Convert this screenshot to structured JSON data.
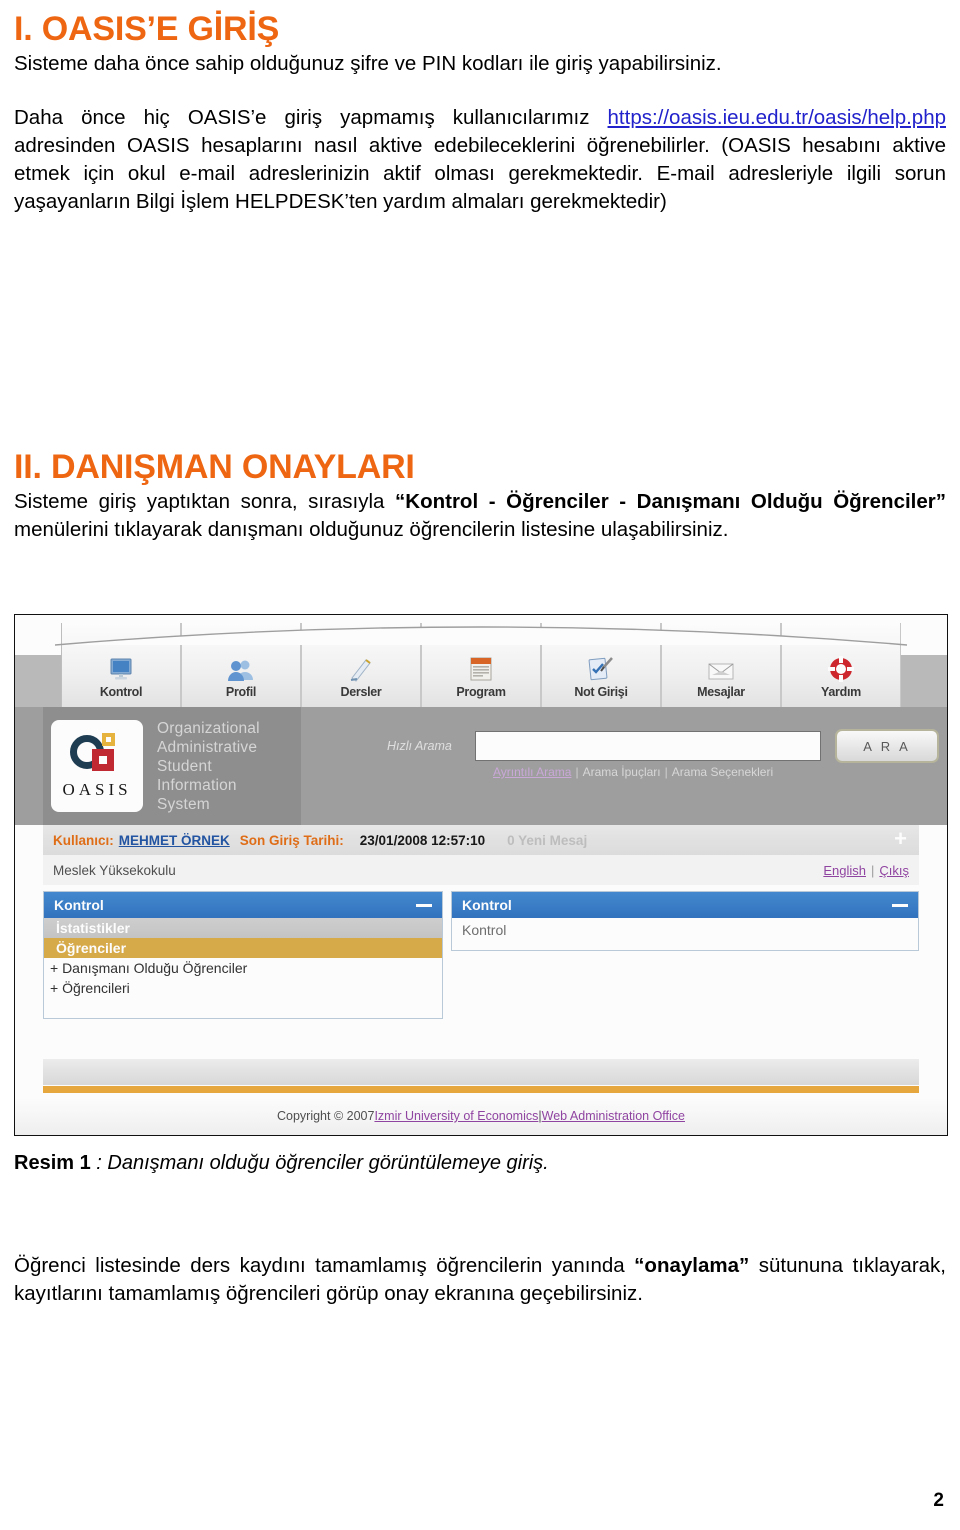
{
  "document": {
    "section1": {
      "heading": "I. OASIS’E GİRİŞ",
      "para1": "Sisteme daha önce sahip olduğunuz şifre ve PIN kodları ile giriş yapabilirsiniz.",
      "para2_pre": "Daha önce hiç OASIS’e giriş yapmamış kullanıcılarımız ",
      "para2_link": "https://oasis.ieu.edu.tr/oasis/help.php",
      "para2_post": " adresinden OASIS hesaplarını nasıl aktive edebileceklerini öğrenebilirler. (OASIS hesabını aktive etmek için okul e-mail adreslerinizin aktif olması gerekmektedir. E-mail adresleriyle ilgili sorun yaşayanların Bilgi İşlem HELPDESK’ten yardım almaları gerekmektedir)"
    },
    "section2": {
      "heading": "II. DANIŞMAN ONAYLARI",
      "para_pre": "Sisteme giriş yaptıktan sonra, sırasıyla ",
      "para_bold": "“Kontrol - Öğrenciler - Danışmanı Olduğu Öğrenciler”",
      "para_post": " menülerini tıklayarak danışmanı olduğunuz öğrencilerin listesine ulaşabilirsiniz."
    },
    "caption": {
      "label": "Resim 1",
      "text": " : Danışmanı olduğu öğrenciler görüntülemeye giriş."
    },
    "closing": {
      "pre": "Öğrenci listesinde ders kaydını tamamlamış öğrencilerin yanında ",
      "bold": "“onaylama”",
      "post": " sütununa tıklayarak, kayıtlarını tamamlamış öğrencileri görüp onay ekranına geçebilirsiniz."
    },
    "page_number": "2"
  },
  "screenshot": {
    "tabs": [
      {
        "label": "Kontrol",
        "icon": "monitor-icon"
      },
      {
        "label": "Profil",
        "icon": "users-icon"
      },
      {
        "label": "Dersler",
        "icon": "pen-paper-icon"
      },
      {
        "label": "Program",
        "icon": "calendar-icon"
      },
      {
        "label": "Not Girişi",
        "icon": "checklist-pen-icon"
      },
      {
        "label": "Mesajlar",
        "icon": "envelope-icon"
      },
      {
        "label": "Yardım",
        "icon": "lifebuoy-icon"
      }
    ],
    "brand": {
      "logo_text": "OASIS",
      "expansion_line1": "Organizational",
      "expansion_line2": "Administrative",
      "expansion_line3": "Student",
      "expansion_line4": "Information",
      "expansion_line5": "System"
    },
    "search": {
      "label": "Hızlı Arama",
      "value": "",
      "button_label": "A R A",
      "link_detailed": "Ayrıntılı Arama",
      "link_tips": "Arama İpuçları",
      "link_options": "Arama Seçenekleri",
      "separator": "|"
    },
    "userbar": {
      "user_label": "Kullanıcı:",
      "user_name": "MEHMET ÖRNEK",
      "lastlogin_label": "Son Giriş Tarihi:",
      "lastlogin_value": "23/01/2008 12:57:10",
      "messages": "0 Yeni Mesaj",
      "plus": "+",
      "unit": "Meslek Yüksekokulu",
      "english_link": "English",
      "logout_link": "Çıkış",
      "link_sep": "|"
    },
    "left_panel": {
      "title": "Kontrol",
      "items": [
        {
          "label": "İstatistikler",
          "state": "grey"
        },
        {
          "label": "Öğrenciler",
          "state": "selected"
        },
        {
          "label": "+ Danışmanı Olduğu Öğrenciler",
          "state": "plain"
        },
        {
          "label": "+ Öğrencileri",
          "state": "plain"
        }
      ]
    },
    "right_panel": {
      "title": "Kontrol",
      "body": "Kontrol"
    },
    "footer": {
      "copyright_pre": "Copyright © 2007 ",
      "link1": "Izmir University of Economics",
      "sep": "|",
      "link2": "Web Administration Office"
    }
  },
  "colors": {
    "heading_orange": "#EE6611",
    "link_blue": "#2222CC",
    "panel_blue": "#2C6FBD",
    "selected_gold": "#D8A944",
    "accent_orange_bar": "#E8A63A"
  }
}
